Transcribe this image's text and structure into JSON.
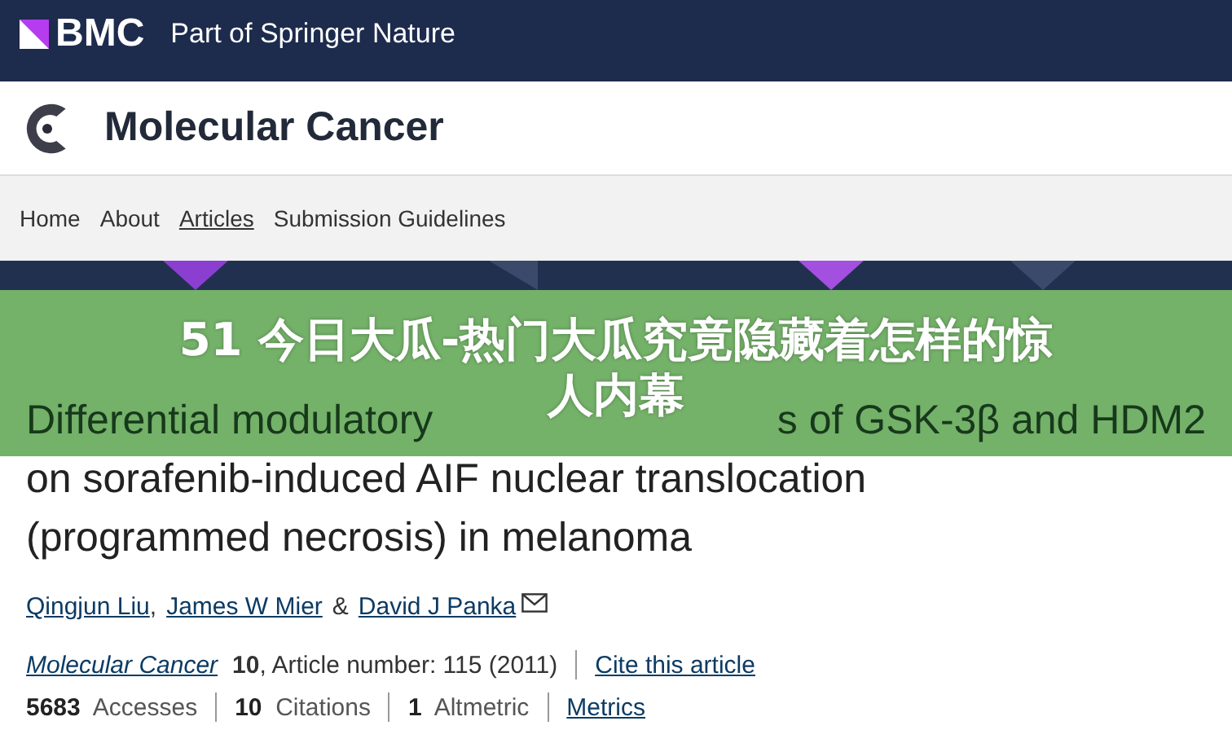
{
  "topbar": {
    "brand": "BMC",
    "tagline": "Part of Springer Nature"
  },
  "journal": {
    "title": "Molecular Cancer"
  },
  "nav": [
    {
      "label": "Home",
      "selected": false
    },
    {
      "label": "About",
      "selected": false
    },
    {
      "label": "Articles",
      "selected": true
    },
    {
      "label": "Submission Guidelines",
      "selected": false
    }
  ],
  "banner": {
    "headline_lines": [
      "51 今日大瓜-热门大瓜究竟隐藏着怎样的惊",
      "人内幕"
    ]
  },
  "article": {
    "title_line_1_parts": [
      "Differential modulatory",
      "s of GSK-3β and HDM2"
    ],
    "title_lines": [
      "on sorafenib-induced AIF nuclear translocation",
      "(programmed necrosis) in melanoma"
    ],
    "authors": [
      "Qingjun Liu",
      "James W Mier",
      "David J Panka"
    ],
    "author_separators": [
      ",",
      "&"
    ],
    "journal_link": "Molecular Cancer",
    "volume": "10",
    "article_number": ", Article number: 115 (2011)",
    "cite": "Cite this article",
    "metrics": [
      "**5683**  Accesses",
      "**10**  Citations",
      "**1**  Altmetric"
    ],
    "metrics_link": "Metrics"
  }
}
